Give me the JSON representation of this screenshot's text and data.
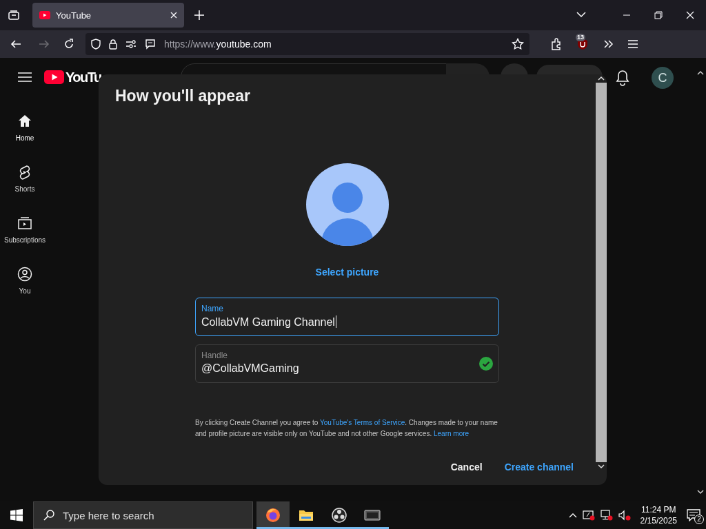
{
  "browser": {
    "tabs": [
      {
        "title": "YouTube",
        "selected": true
      }
    ],
    "url": {
      "prefix": "https://www.",
      "domain": "youtube.com"
    },
    "extension_badge": "13"
  },
  "youtube": {
    "logo": "YouTu",
    "avatar_letter": "C",
    "sidebar": [
      {
        "label": "Home",
        "kind": "home",
        "selected": true
      },
      {
        "label": "Shorts",
        "kind": "shorts",
        "selected": false
      },
      {
        "label": "Subscriptions",
        "kind": "subscriptions",
        "selected": false
      },
      {
        "label": "You",
        "kind": "you",
        "selected": false
      }
    ]
  },
  "dialog": {
    "title": "How you'll appear",
    "select_picture": "Select picture",
    "fields": [
      {
        "label": "Name",
        "value": "CollabVM Gaming Channel",
        "focused": true,
        "valid": false
      },
      {
        "label": "Handle",
        "value": "@CollabVMGaming",
        "focused": false,
        "valid": true
      }
    ],
    "notice": [
      {
        "kind": "text",
        "text": "By clicking Create Channel you agree to "
      },
      {
        "kind": "link",
        "text": "YouTube's Terms of Service"
      },
      {
        "kind": "text",
        "text": ". Changes made to your name and profile picture are visible only on YouTube and not other Google services. "
      },
      {
        "kind": "link",
        "text": "Learn more"
      }
    ],
    "buttons": [
      {
        "label": "Cancel",
        "primary": false
      },
      {
        "label": "Create channel",
        "primary": true
      }
    ]
  },
  "taskbar": {
    "search_placeholder": "Type here to search",
    "apps": [
      {
        "kind": "firefox",
        "selected": true
      },
      {
        "kind": "folder",
        "selected": false
      },
      {
        "kind": "obs",
        "selected": false
      },
      {
        "kind": "vm",
        "selected": false
      }
    ],
    "time": "11:24 PM",
    "date": "2/15/2025",
    "notifications": "2"
  }
}
